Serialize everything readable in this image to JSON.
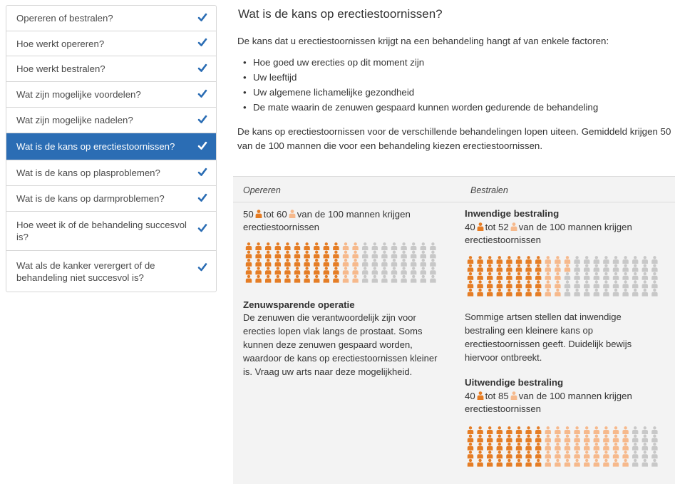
{
  "sidebar": {
    "items": [
      {
        "label": "Opereren of bestralen?",
        "checked": true,
        "active": false
      },
      {
        "label": "Hoe werkt opereren?",
        "checked": true,
        "active": false
      },
      {
        "label": "Hoe werkt bestralen?",
        "checked": true,
        "active": false
      },
      {
        "label": "Wat zijn mogelijke voordelen?",
        "checked": true,
        "active": false
      },
      {
        "label": "Wat zijn mogelijke nadelen?",
        "checked": true,
        "active": false
      },
      {
        "label": "Wat is de kans op erectiestoornissen?",
        "checked": true,
        "active": true
      },
      {
        "label": "Wat is de kans op plasproblemen?",
        "checked": true,
        "active": false
      },
      {
        "label": "Wat is de kans op darmproblemen?",
        "checked": true,
        "active": false
      },
      {
        "label": "Hoe weet ik of de behandeling succesvol is?",
        "checked": true,
        "active": false
      },
      {
        "label": "Wat als de kanker verergert of de behandeling niet succesvol is?",
        "checked": true,
        "active": false
      }
    ]
  },
  "main": {
    "title": "Wat is de kans op erectiestoornissen?",
    "intro": "De kans dat u erectiestoornissen krijgt na een behandeling hangt af van enkele factoren:",
    "bullets": [
      "Hoe goed uw erecties op dit moment zijn",
      "Uw leeftijd",
      "Uw algemene lichamelijke gezondheid",
      "De mate waarin de zenuwen gespaard kunnen worden gedurende de behandeling"
    ],
    "paragraph": "De kans op erectiestoornissen voor de verschillende behandelingen lopen uiteen. Gemiddeld krijgen 50 van de 100 mannen die voor een behandeling kiezen erectiestoornissen."
  },
  "comparison": {
    "col_left": "Opereren",
    "col_right": "Bestralen",
    "word_tot": "tot",
    "word_suffix": "van de 100 mannen krijgen",
    "word_outcome": "erectiestoornissen",
    "opereren": {
      "low": "50",
      "high": "60"
    },
    "inwendig": {
      "heading": "Inwendige bestraling",
      "low": "40",
      "high": "52",
      "note": "Sommige artsen stellen dat inwendige bestraling een kleinere kans op erectiestoornissen geeft. Duidelijk bewijs hiervoor ontbreekt."
    },
    "uitwendig": {
      "heading": "Uitwendige bestraling",
      "low": "40",
      "high": "85"
    },
    "zenuw": {
      "heading": "Zenuwsparende operatie",
      "text": "De zenuwen die verantwoordelijk zijn voor erecties lopen vlak langs de prostaat. Soms kunnen deze zenuwen gespaard worden, waardoor de kans op erectiestoornissen kleiner is. Vraag uw arts naar deze mogelijkheid."
    }
  },
  "chart_data": [
    {
      "type": "icon-array",
      "name": "Opereren",
      "total": 100,
      "certain": 50,
      "possible": 10
    },
    {
      "type": "icon-array",
      "name": "Inwendige bestraling",
      "total": 100,
      "certain": 40,
      "possible": 12
    },
    {
      "type": "icon-array",
      "name": "Uitwendige bestraling",
      "total": 100,
      "certain": 40,
      "possible": 45
    }
  ],
  "colors": {
    "accent": "#2b6db4",
    "check": "#2b6db4",
    "certain": "#e57d25",
    "possible": "#f6b98c",
    "unaffected": "#c8c8c8"
  },
  "icons": {
    "check": "check-icon",
    "person": "person-icon"
  }
}
